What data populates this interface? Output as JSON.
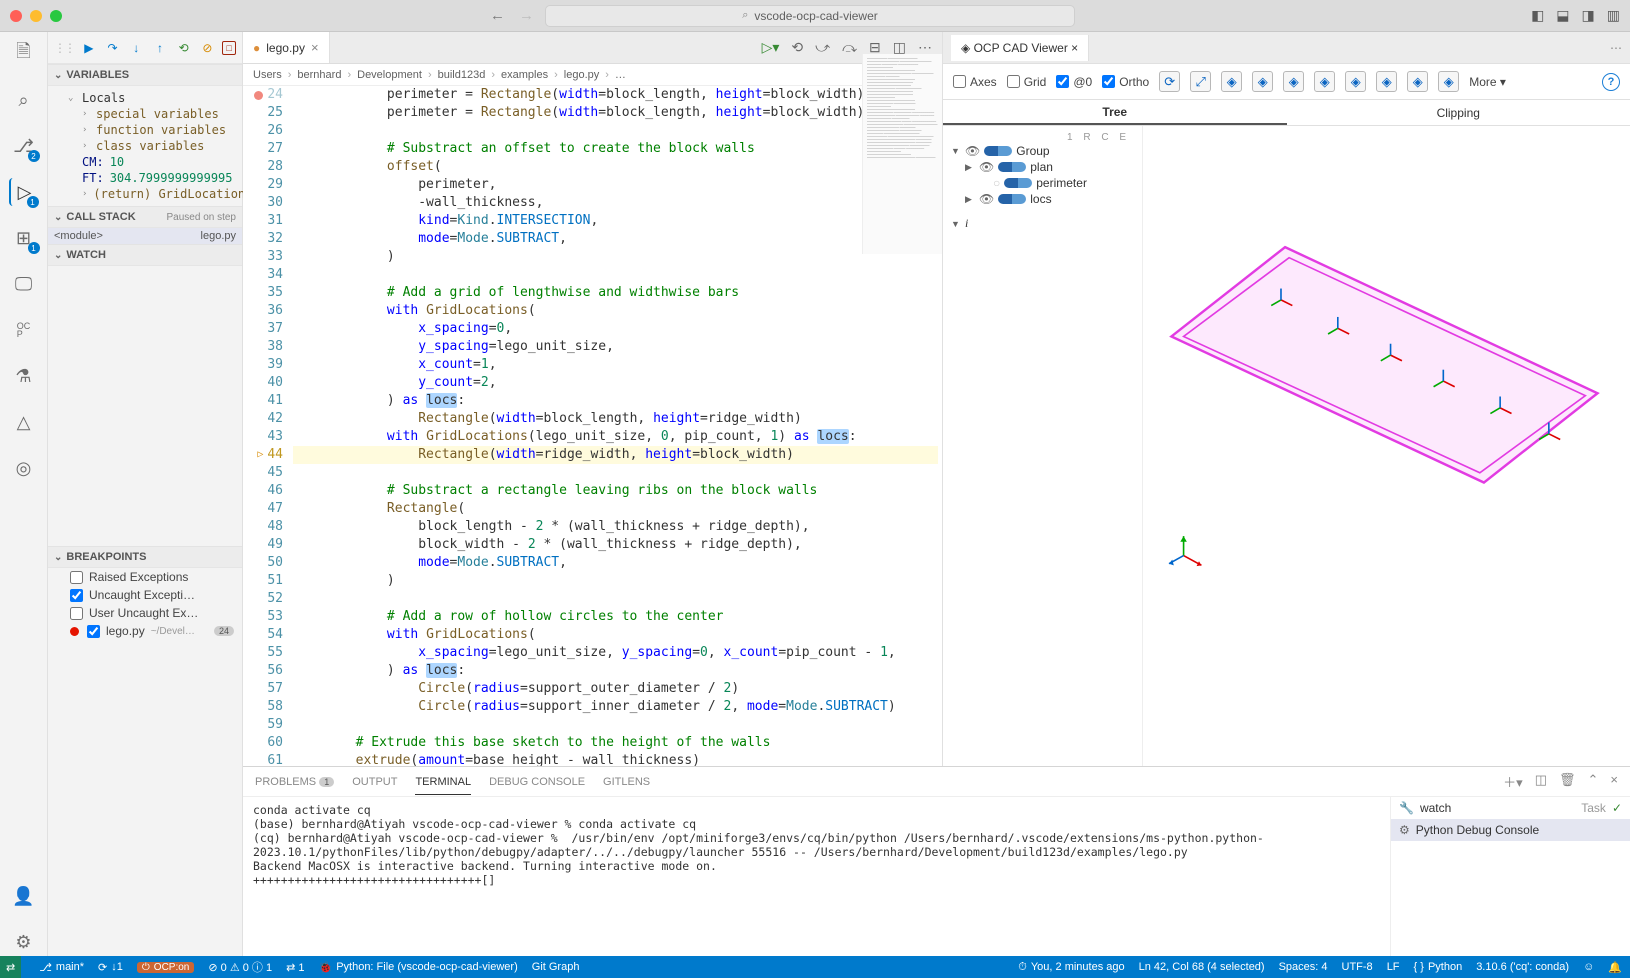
{
  "window": {
    "title": "vscode-ocp-cad-viewer",
    "search_icon": "🔍"
  },
  "activitybar": {
    "scm_badge": "2",
    "debug_badge": "1",
    "ext_badge": "1"
  },
  "debug": {
    "variables": "VARIABLES",
    "locals": "Locals",
    "special_vars": "special variables",
    "function_vars": "function variables",
    "class_vars": "class variables",
    "cm_label": "CM:",
    "cm_val": "10",
    "ft_label": "FT:",
    "ft_val": "304.7999999999995",
    "return_label": "(return) GridLocations.",
    "callstack": "CALL STACK",
    "paused": "Paused on step",
    "module": "<module>",
    "file": "lego.py",
    "watch": "WATCH",
    "breakpoints": "BREAKPOINTS",
    "bp_raised": "Raised Exceptions",
    "bp_uncaught": "Uncaught Excepti…",
    "bp_user": "User Uncaught Ex…",
    "bp_lego": "lego.py",
    "bp_lego_path": "~/Devel…",
    "bp_lego_count": "24"
  },
  "tabs": {
    "lego": "lego.py",
    "ocp": "OCP CAD Viewer"
  },
  "breadcrumb": [
    "Users",
    "bernhard",
    "Development",
    "build123d",
    "examples",
    "lego.py",
    "…"
  ],
  "code": {
    "start": 24,
    "lines": [
      {
        "raw": "            perimeter = Rectangle(width=block_length, height=block_width)",
        "bp": true
      },
      {
        "raw": "            perimeter = Rectangle(width=block_length, height=block_width)"
      },
      {
        "raw": ""
      },
      {
        "raw": "            # Substract an offset to create the block walls",
        "comment": true
      },
      {
        "raw": "            offset("
      },
      {
        "raw": "                perimeter,"
      },
      {
        "raw": "                -wall_thickness,"
      },
      {
        "raw": "                kind=Kind.INTERSECTION,"
      },
      {
        "raw": "                mode=Mode.SUBTRACT,"
      },
      {
        "raw": "            )"
      },
      {
        "raw": ""
      },
      {
        "raw": "            # Add a grid of lengthwise and widthwise bars",
        "comment": true
      },
      {
        "raw": "            with GridLocations("
      },
      {
        "raw": "                x_spacing=0,"
      },
      {
        "raw": "                y_spacing=lego_unit_size,"
      },
      {
        "raw": "                x_count=1,"
      },
      {
        "raw": "                y_count=2,"
      },
      {
        "raw": "            ) as locs:"
      },
      {
        "raw": "                Rectangle(width=block_length, height=ridge_width)"
      },
      {
        "raw": "            with GridLocations(lego_unit_size, 0, pip_count, 1) as locs:"
      },
      {
        "raw": "                Rectangle(width=ridge_width, height=block_width)",
        "current": true
      },
      {
        "raw": ""
      },
      {
        "raw": "            # Substract a rectangle leaving ribs on the block walls",
        "comment": true
      },
      {
        "raw": "            Rectangle("
      },
      {
        "raw": "                block_length - 2 * (wall_thickness + ridge_depth),"
      },
      {
        "raw": "                block_width - 2 * (wall_thickness + ridge_depth),"
      },
      {
        "raw": "                mode=Mode.SUBTRACT,"
      },
      {
        "raw": "            )"
      },
      {
        "raw": ""
      },
      {
        "raw": "            # Add a row of hollow circles to the center",
        "comment": true
      },
      {
        "raw": "            with GridLocations("
      },
      {
        "raw": "                x_spacing=lego_unit_size, y_spacing=0, x_count=pip_count - 1,"
      },
      {
        "raw": "            ) as locs:"
      },
      {
        "raw": "                Circle(radius=support_outer_diameter / 2)"
      },
      {
        "raw": "                Circle(radius=support_inner_diameter / 2, mode=Mode.SUBTRACT)"
      },
      {
        "raw": ""
      },
      {
        "raw": "        # Extrude this base sketch to the height of the walls",
        "comment": true
      },
      {
        "raw": "        extrude(amount=base_height - wall_thickness)"
      }
    ]
  },
  "cad": {
    "axes": "Axes",
    "grid": "Grid",
    "at0": "@0",
    "ortho": "Ortho",
    "more": "More ▾",
    "tab_tree": "Tree",
    "tab_clip": "Clipping",
    "hdr": "1  R  C  E",
    "group": "Group",
    "plan": "plan",
    "perimeter": "perimeter",
    "locs": "locs",
    "info": "i"
  },
  "panel": {
    "problems": "PROBLEMS",
    "problems_n": "1",
    "output": "OUTPUT",
    "terminal": "TERMINAL",
    "debug_console": "DEBUG CONSOLE",
    "gitlens": "GITLENS",
    "task_watch": "watch",
    "task_watch_tag": "Task",
    "task_py": "Python Debug Console",
    "term": "conda activate cq\n(base) bernhard@Atiyah vscode-ocp-cad-viewer % conda activate cq\n(cq) bernhard@Atiyah vscode-ocp-cad-viewer %  /usr/bin/env /opt/miniforge3/envs/cq/bin/python /Users/bernhard/.vscode/extensions/ms-python.python-2023.10.1/pythonFiles/lib/python/debugpy/adapter/../../debugpy/launcher 55516 -- /Users/bernhard/Development/build123d/examples/lego.py \nBackend MacOSX is interactive backend. Turning interactive mode on.\n+++++++++++++++++++++++++++++++++[]"
  },
  "status": {
    "branch": "main*",
    "sync": "↓1",
    "ocp": "OCP:on",
    "diag": "⊘ 0 ⚠ 0 ⓘ 1",
    "port": "⇄ 1",
    "launch": "Python: File (vscode-ocp-cad-viewer)",
    "gitgraph": "Git Graph",
    "blame": "You, 2 minutes ago",
    "pos": "Ln 42, Col 68 (4 selected)",
    "spaces": "Spaces: 4",
    "enc": "UTF-8",
    "eol": "LF",
    "lang": "Python",
    "interp": "3.10.6 ('cq': conda)"
  }
}
